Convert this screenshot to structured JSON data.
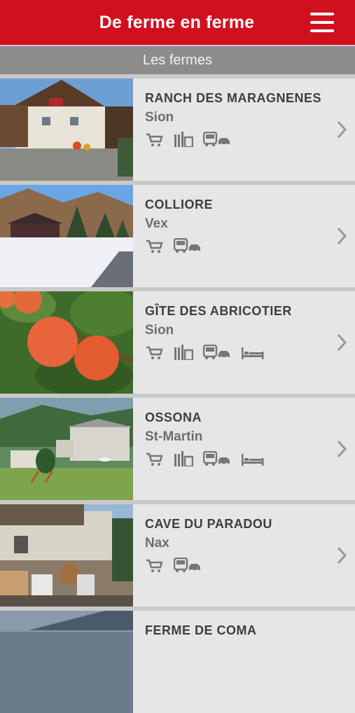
{
  "header": {
    "title": "De ferme en ferme",
    "menu_icon": "hamburger-menu-icon"
  },
  "subheader": {
    "title": "Les fermes"
  },
  "farms": [
    {
      "name": "RANCH DES MARAGNENES",
      "town": "Sion",
      "services": [
        "cart-icon",
        "restaurant-icon",
        "bus-car-icon"
      ]
    },
    {
      "name": "COLLIORE",
      "town": "Vex",
      "services": [
        "cart-icon",
        "bus-car-icon"
      ]
    },
    {
      "name": "GÎTE DES ABRICOTIER",
      "town": "Sion",
      "services": [
        "cart-icon",
        "restaurant-icon",
        "bus-car-icon",
        "bed-icon"
      ]
    },
    {
      "name": "OSSONA",
      "town": "St-Martin",
      "services": [
        "cart-icon",
        "restaurant-icon",
        "bus-car-icon",
        "bed-icon"
      ]
    },
    {
      "name": "CAVE DU PARADOU",
      "town": "Nax",
      "services": [
        "cart-icon",
        "bus-car-icon"
      ]
    },
    {
      "name": "FERME DE COMA",
      "town": "",
      "services": []
    }
  ],
  "colors": {
    "brand_red": "#d0101f",
    "subbar_gray": "#8c8c8c",
    "row_bg": "#e6e6e6",
    "icon_gray": "#777777"
  }
}
